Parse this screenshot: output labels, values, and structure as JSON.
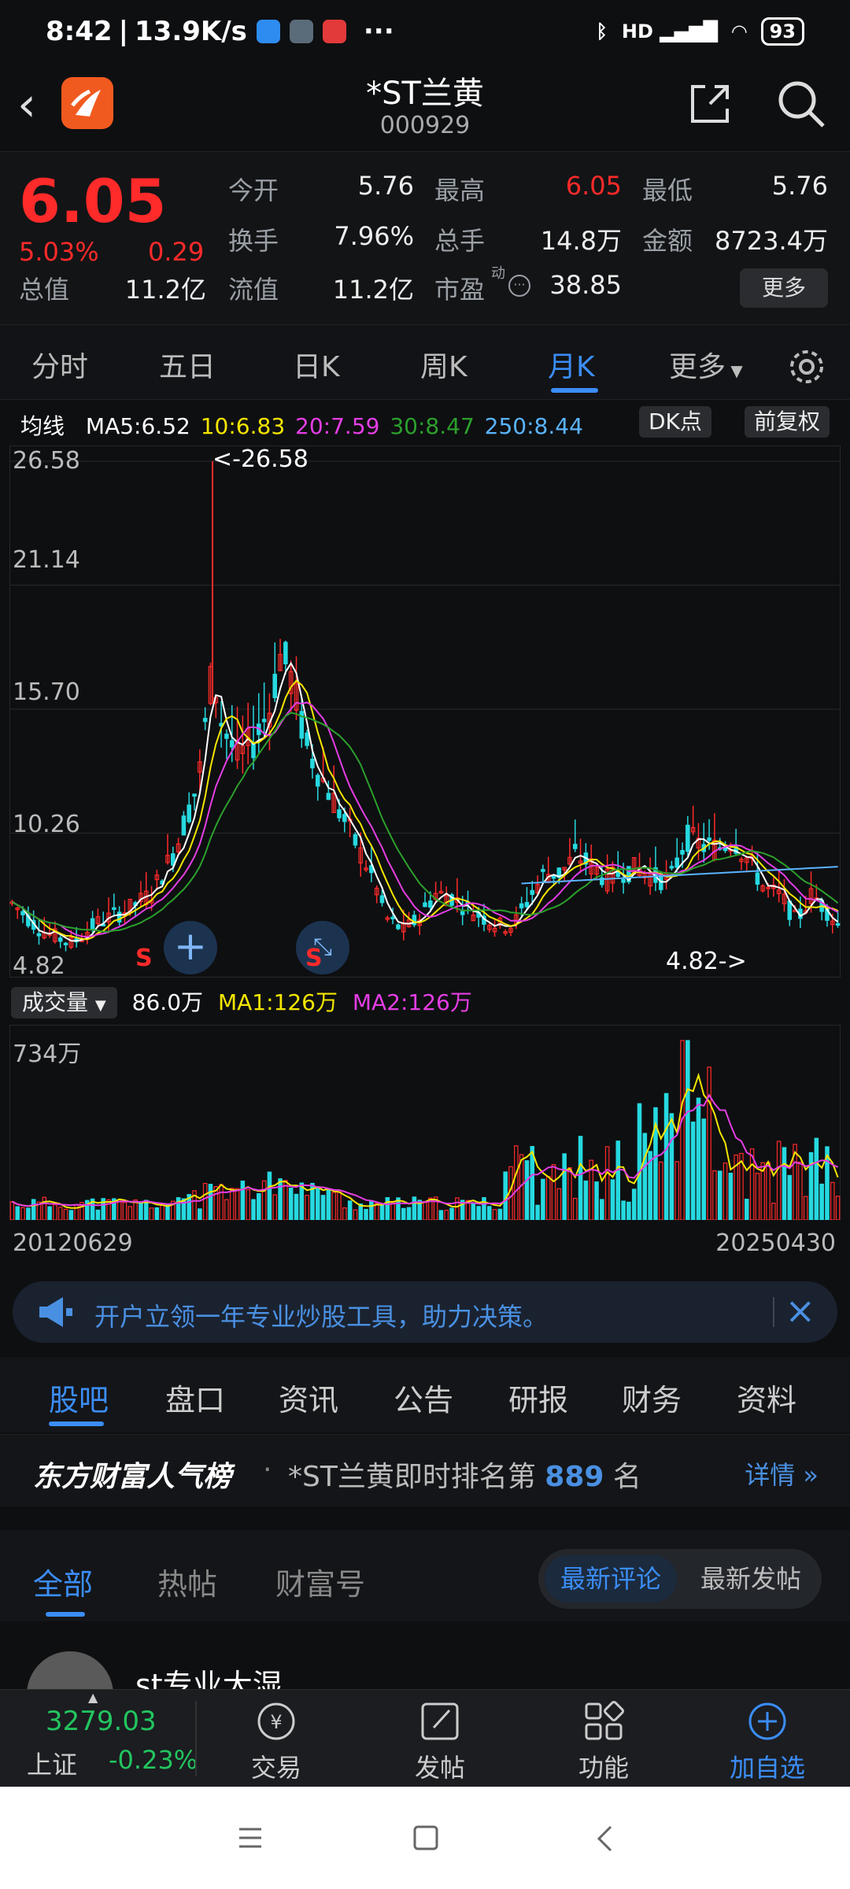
{
  "status": {
    "time": "8:42",
    "speed": "13.9K/s",
    "dots": "···",
    "network": "HD",
    "battery": "93"
  },
  "header": {
    "title": "*ST兰黄",
    "code": "000929"
  },
  "quote": {
    "price": "6.05",
    "change_pct": "5.03%",
    "change": "0.29",
    "labels": {
      "open": "今开",
      "high": "最高",
      "low": "最低",
      "turnover": "换手",
      "volume": "总手",
      "amount": "金额",
      "total_cap": "总值",
      "float_cap": "流值",
      "pe": "市盈"
    },
    "values": {
      "open": "5.76",
      "high": "6.05",
      "low": "5.76",
      "turnover": "7.96%",
      "volume": "14.8万",
      "amount": "8723.4万",
      "total_cap": "11.2亿",
      "float_cap": "11.2亿",
      "pe": "38.85"
    },
    "pe_mark": "动",
    "more": "更多"
  },
  "period_tabs": [
    "分时",
    "五日",
    "日K",
    "周K",
    "月K",
    "更多"
  ],
  "ma_legend": {
    "label": "均线",
    "ma5": "MA5:6.52",
    "ma10": "10:6.83",
    "ma20": "20:7.59",
    "ma30": "30:8.47",
    "ma250": "250:8.44",
    "dk": "DK点",
    "fuquan": "前复权"
  },
  "chart_data": {
    "type": "candlestick",
    "y_ticks": [
      "26.58",
      "21.14",
      "15.70",
      "10.26",
      "4.82"
    ],
    "max_label": "<-26.58",
    "min_label": "4.82->",
    "xlabels": [
      "20120629",
      "20250430"
    ],
    "ylim": [
      4.82,
      26.58
    ],
    "markers": [
      "S",
      "S"
    ],
    "colors": {
      "up": "#ff2a2a",
      "down": "#26d9e0",
      "ma5": "#ffffff",
      "ma10": "#f5e600",
      "ma20": "#e43ee4",
      "ma30": "#2ca02c",
      "ma250": "#5ab4ff"
    },
    "volume": {
      "label": "成交量",
      "value": "86.0万",
      "ma1": "MA1:126万",
      "ma2": "MA2:126万",
      "max_tick": "734万"
    }
  },
  "banner": {
    "text": "开户立领一年专业炒股工具，助力决策。"
  },
  "section_tabs": [
    "股吧",
    "盘口",
    "资讯",
    "公告",
    "研报",
    "财务",
    "资料"
  ],
  "rank": {
    "brand": "东方财富人气榜",
    "prefix": "*ST兰黄即时排名第",
    "number": "889",
    "suffix": "名",
    "detail": "详情"
  },
  "filter_tabs": [
    "全部",
    "热帖",
    "财富号"
  ],
  "sort": {
    "latest_comment": "最新评论",
    "latest_post": "最新发帖"
  },
  "post": {
    "author": "st专业大湿"
  },
  "bottom": {
    "index_value": "3279.03",
    "index_name": "上证",
    "index_pct": "-0.23%",
    "items": [
      "交易",
      "发帖",
      "功能",
      "加自选"
    ]
  }
}
